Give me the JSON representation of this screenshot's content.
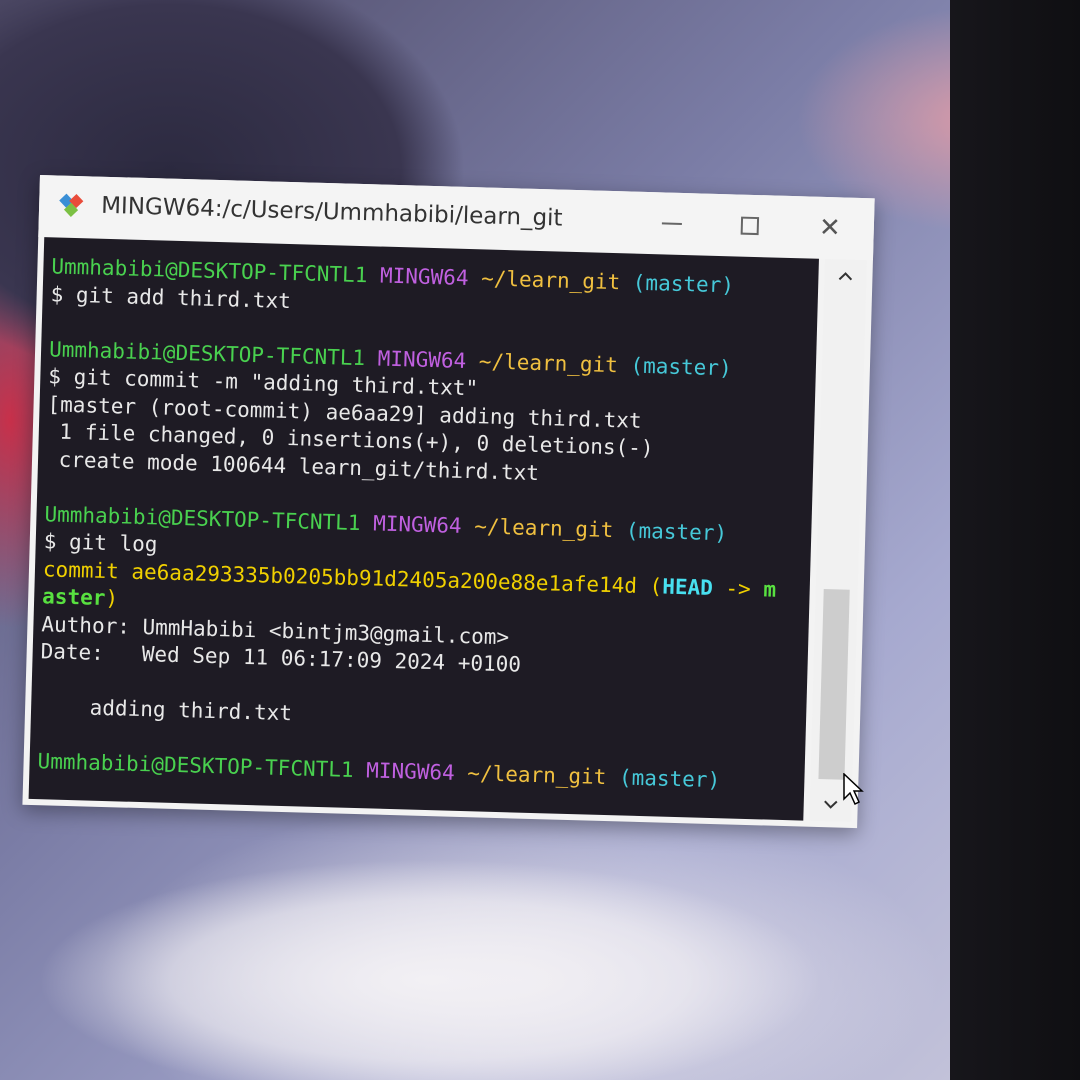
{
  "window": {
    "title": "MINGW64:/c/Users/Ummhabibi/learn_git",
    "minimize_glyph": "—",
    "maximize_glyph": "☐",
    "close_glyph": "✕"
  },
  "colors": {
    "user_host": "#49d14f",
    "mingw": "#c060e0",
    "path": "#f0c040",
    "branch": "#46c8d8",
    "commit": "#f0d000",
    "terminal_bg": "#1e1b24"
  },
  "terminal": {
    "prompt_user": "Ummhabibi@DESKTOP-TFCNTL1",
    "prompt_env": "MINGW64",
    "prompt_path": "~/learn_git",
    "prompt_branch": "(master)",
    "cmd1": "$ git add third.txt",
    "cmd2": "$ git commit -m \"adding third.txt\"",
    "out2_1": "[master (root-commit) ae6aa29] adding third.txt",
    "out2_2": " 1 file changed, 0 insertions(+), 0 deletions(-)",
    "out2_3": " create mode 100644 learn_git/third.txt",
    "cmd3": "$ git log",
    "commit_label": "commit ae6aa293335b0205bb91d2405a200e88e1afe14d (",
    "head": "HEAD",
    "arrow": " -> ",
    "branch_wrap1": "m",
    "branch_wrap2": "aster",
    "commit_close": ")",
    "author": "Author: UmmHabibi <bintjm3@gmail.com>",
    "date": "Date:   Wed Sep 11 06:17:09 2024 +0100",
    "message": "    adding third.txt"
  },
  "icons": {
    "app": "git-bash-icon",
    "scroll_up": "chevron-up-icon",
    "scroll_down": "chevron-down-icon",
    "cursor": "mouse-pointer-icon"
  }
}
